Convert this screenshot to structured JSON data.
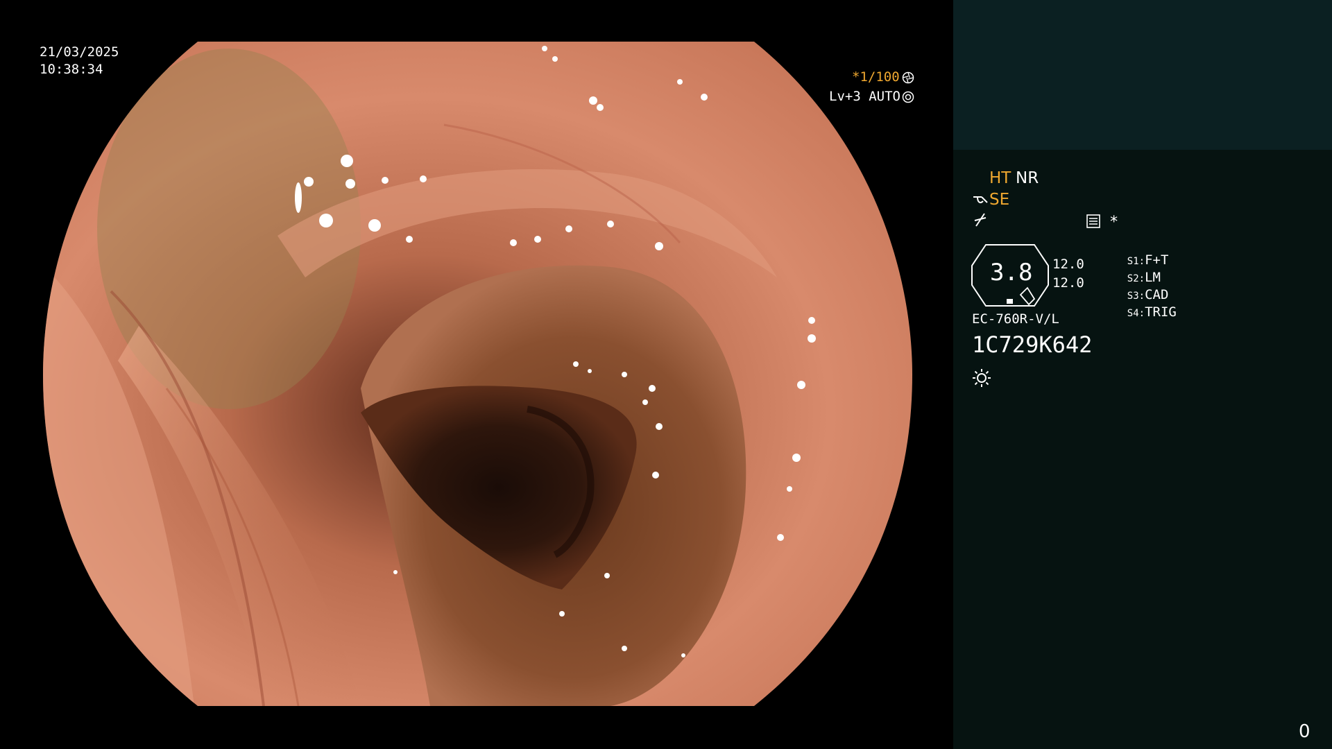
{
  "viewer": {
    "date": "21/03/2025",
    "time": "10:38:34",
    "shutter": "*1/100",
    "shutter_icon": "aperture-icon",
    "level": "Lv+3 AUTO",
    "level_icon": "iris-icon"
  },
  "panel": {
    "mode_ht": "HT",
    "mode_nr": "NR",
    "mode_se": "SE",
    "star": "*",
    "zoom_value": "3.8",
    "val_1": "12.0",
    "val_2": "12.0",
    "switches": [
      {
        "key": "S1:",
        "value": "F+T"
      },
      {
        "key": "S2:",
        "value": "LM"
      },
      {
        "key": "S3:",
        "value": "CAD"
      },
      {
        "key": "S4:",
        "value": "TRIG"
      }
    ],
    "scope_model": "EC-760R-V/L",
    "serial": "1C729K642",
    "counter": "0"
  },
  "colors": {
    "accent_orange": "#f0a830",
    "panel_top": "#0b2022",
    "panel_bottom": "#061311"
  }
}
